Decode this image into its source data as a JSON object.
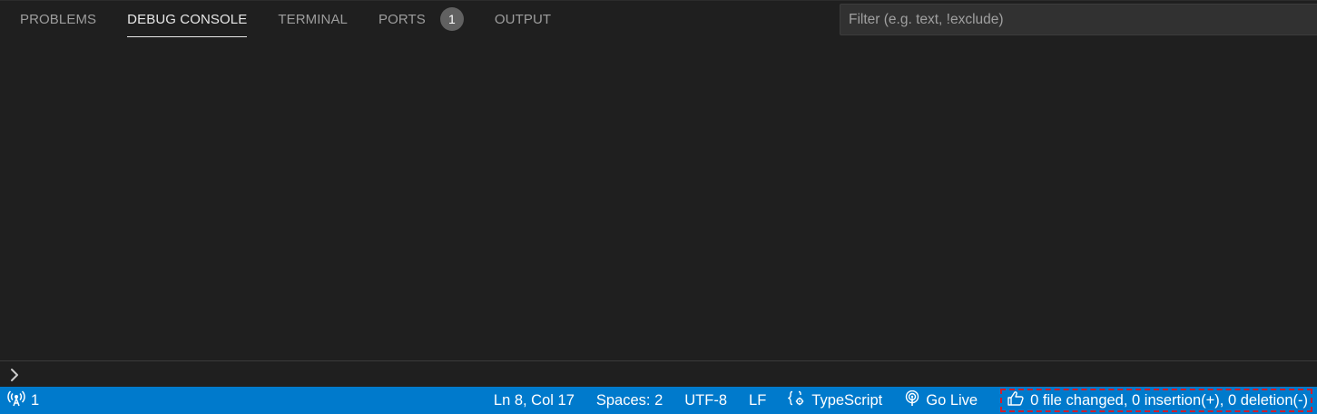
{
  "panel": {
    "tabs": [
      {
        "label": "PROBLEMS",
        "active": false
      },
      {
        "label": "DEBUG CONSOLE",
        "active": true
      },
      {
        "label": "TERMINAL",
        "active": false
      },
      {
        "label": "PORTS",
        "active": false,
        "badge": "1"
      },
      {
        "label": "OUTPUT",
        "active": false
      }
    ],
    "filter": {
      "placeholder": "Filter (e.g. text, !exclude)",
      "value": ""
    },
    "prompt": {
      "icon": "chevron-right-icon",
      "value": ""
    }
  },
  "statusbar": {
    "background": "#007acc",
    "remote": {
      "icon": "broadcast-icon",
      "label": "1"
    },
    "cursor_position": "Ln 8, Col 17",
    "indentation": "Spaces: 2",
    "encoding": "UTF-8",
    "eol": "LF",
    "language": {
      "icon": "braces-gear-icon",
      "label": "TypeScript"
    },
    "go_live": {
      "icon": "broadcast-tower-icon",
      "label": "Go Live"
    },
    "git_stats": {
      "icon": "thumbs-up-icon",
      "label": "0 file changed, 0 insertion(+), 0 deletion(-)"
    }
  }
}
